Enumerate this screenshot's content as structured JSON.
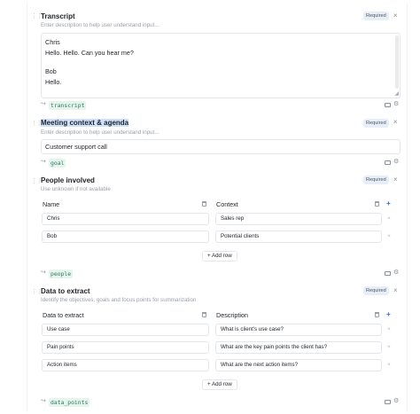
{
  "sections": [
    {
      "title": "Transcript",
      "description": "Enter description to help user understand input...",
      "required": "Required",
      "lines": [
        "Chris",
        "Hello. Hello. Can you hear me?",
        "Bob",
        "Hello."
      ],
      "variable": "transcript"
    },
    {
      "title": "Meeting context & agenda",
      "description": "Enter description to help user understand input...",
      "required": "Required",
      "value": "Customer support call",
      "variable": "goal"
    },
    {
      "title": "People involved",
      "description": "Use unknown if not available",
      "required": "Required",
      "columns": [
        "Name",
        "Context"
      ],
      "rows": [
        [
          "Chris",
          "Sales rep"
        ],
        [
          "Bob",
          "Potential clients"
        ]
      ],
      "add_row": "+ Add row",
      "variable": "people"
    },
    {
      "title": "Data to extract",
      "description": "Identify the objectives, goals and focus points for summarization",
      "required": "Required",
      "columns": [
        "Data to extract",
        "Description"
      ],
      "rows": [
        [
          "Use case",
          "What is client's use case?"
        ],
        [
          "Pain points",
          "What are the key pain points the client has?"
        ],
        [
          "Action items",
          "What are the next action items?"
        ]
      ],
      "add_row": "+ Add row",
      "variable": "data_points"
    }
  ],
  "icons": {
    "drag": "drag-handle-icon",
    "close": "close-icon",
    "variable": "corner-arrow-icon",
    "preview": "preview-icon",
    "settings": "gear-icon",
    "delete": "trash-icon",
    "add": "plus-icon"
  },
  "colors": {
    "accent": "#2b6fd6",
    "tag_text": "#2f7a5e",
    "tag_bg": "#e6f4ee",
    "required_bg": "#e8eef6",
    "selection": "#cfe1fb"
  }
}
